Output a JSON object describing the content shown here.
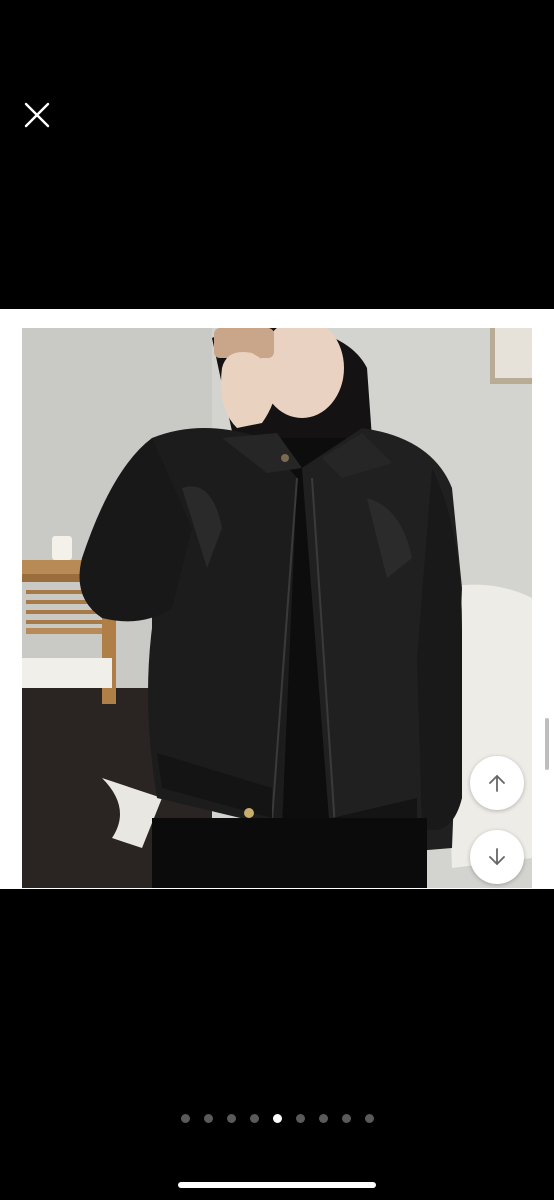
{
  "viewer": {
    "close_icon": "close-icon",
    "up_icon": "arrow-up-icon",
    "down_icon": "arrow-down-icon",
    "photo_description_icon": "product-photo"
  },
  "pagination": {
    "count": 9,
    "active_index": 4
  },
  "colors": {
    "background": "#000000",
    "dot_inactive": "#5a5a5a",
    "dot_active": "#ffffff",
    "nav_button_bg": "#ffffff"
  }
}
